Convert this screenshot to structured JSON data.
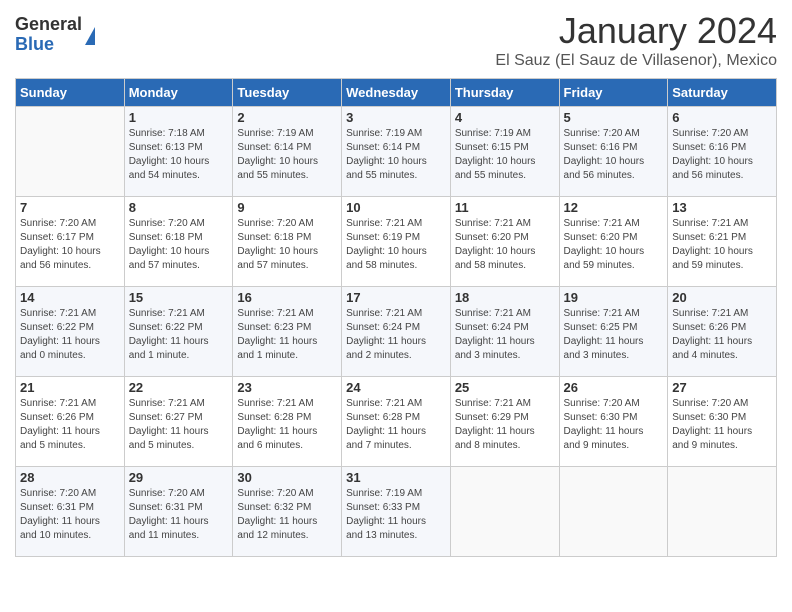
{
  "logo": {
    "general": "General",
    "blue": "Blue"
  },
  "title": "January 2024",
  "location": "El Sauz (El Sauz de Villasenor), Mexico",
  "headers": [
    "Sunday",
    "Monday",
    "Tuesday",
    "Wednesday",
    "Thursday",
    "Friday",
    "Saturday"
  ],
  "weeks": [
    [
      {
        "day": "",
        "info": ""
      },
      {
        "day": "1",
        "info": "Sunrise: 7:18 AM\nSunset: 6:13 PM\nDaylight: 10 hours\nand 54 minutes."
      },
      {
        "day": "2",
        "info": "Sunrise: 7:19 AM\nSunset: 6:14 PM\nDaylight: 10 hours\nand 55 minutes."
      },
      {
        "day": "3",
        "info": "Sunrise: 7:19 AM\nSunset: 6:14 PM\nDaylight: 10 hours\nand 55 minutes."
      },
      {
        "day": "4",
        "info": "Sunrise: 7:19 AM\nSunset: 6:15 PM\nDaylight: 10 hours\nand 55 minutes."
      },
      {
        "day": "5",
        "info": "Sunrise: 7:20 AM\nSunset: 6:16 PM\nDaylight: 10 hours\nand 56 minutes."
      },
      {
        "day": "6",
        "info": "Sunrise: 7:20 AM\nSunset: 6:16 PM\nDaylight: 10 hours\nand 56 minutes."
      }
    ],
    [
      {
        "day": "7",
        "info": "Sunrise: 7:20 AM\nSunset: 6:17 PM\nDaylight: 10 hours\nand 56 minutes."
      },
      {
        "day": "8",
        "info": "Sunrise: 7:20 AM\nSunset: 6:18 PM\nDaylight: 10 hours\nand 57 minutes."
      },
      {
        "day": "9",
        "info": "Sunrise: 7:20 AM\nSunset: 6:18 PM\nDaylight: 10 hours\nand 57 minutes."
      },
      {
        "day": "10",
        "info": "Sunrise: 7:21 AM\nSunset: 6:19 PM\nDaylight: 10 hours\nand 58 minutes."
      },
      {
        "day": "11",
        "info": "Sunrise: 7:21 AM\nSunset: 6:20 PM\nDaylight: 10 hours\nand 58 minutes."
      },
      {
        "day": "12",
        "info": "Sunrise: 7:21 AM\nSunset: 6:20 PM\nDaylight: 10 hours\nand 59 minutes."
      },
      {
        "day": "13",
        "info": "Sunrise: 7:21 AM\nSunset: 6:21 PM\nDaylight: 10 hours\nand 59 minutes."
      }
    ],
    [
      {
        "day": "14",
        "info": "Sunrise: 7:21 AM\nSunset: 6:22 PM\nDaylight: 11 hours\nand 0 minutes."
      },
      {
        "day": "15",
        "info": "Sunrise: 7:21 AM\nSunset: 6:22 PM\nDaylight: 11 hours\nand 1 minute."
      },
      {
        "day": "16",
        "info": "Sunrise: 7:21 AM\nSunset: 6:23 PM\nDaylight: 11 hours\nand 1 minute."
      },
      {
        "day": "17",
        "info": "Sunrise: 7:21 AM\nSunset: 6:24 PM\nDaylight: 11 hours\nand 2 minutes."
      },
      {
        "day": "18",
        "info": "Sunrise: 7:21 AM\nSunset: 6:24 PM\nDaylight: 11 hours\nand 3 minutes."
      },
      {
        "day": "19",
        "info": "Sunrise: 7:21 AM\nSunset: 6:25 PM\nDaylight: 11 hours\nand 3 minutes."
      },
      {
        "day": "20",
        "info": "Sunrise: 7:21 AM\nSunset: 6:26 PM\nDaylight: 11 hours\nand 4 minutes."
      }
    ],
    [
      {
        "day": "21",
        "info": "Sunrise: 7:21 AM\nSunset: 6:26 PM\nDaylight: 11 hours\nand 5 minutes."
      },
      {
        "day": "22",
        "info": "Sunrise: 7:21 AM\nSunset: 6:27 PM\nDaylight: 11 hours\nand 5 minutes."
      },
      {
        "day": "23",
        "info": "Sunrise: 7:21 AM\nSunset: 6:28 PM\nDaylight: 11 hours\nand 6 minutes."
      },
      {
        "day": "24",
        "info": "Sunrise: 7:21 AM\nSunset: 6:28 PM\nDaylight: 11 hours\nand 7 minutes."
      },
      {
        "day": "25",
        "info": "Sunrise: 7:21 AM\nSunset: 6:29 PM\nDaylight: 11 hours\nand 8 minutes."
      },
      {
        "day": "26",
        "info": "Sunrise: 7:20 AM\nSunset: 6:30 PM\nDaylight: 11 hours\nand 9 minutes."
      },
      {
        "day": "27",
        "info": "Sunrise: 7:20 AM\nSunset: 6:30 PM\nDaylight: 11 hours\nand 9 minutes."
      }
    ],
    [
      {
        "day": "28",
        "info": "Sunrise: 7:20 AM\nSunset: 6:31 PM\nDaylight: 11 hours\nand 10 minutes."
      },
      {
        "day": "29",
        "info": "Sunrise: 7:20 AM\nSunset: 6:31 PM\nDaylight: 11 hours\nand 11 minutes."
      },
      {
        "day": "30",
        "info": "Sunrise: 7:20 AM\nSunset: 6:32 PM\nDaylight: 11 hours\nand 12 minutes."
      },
      {
        "day": "31",
        "info": "Sunrise: 7:19 AM\nSunset: 6:33 PM\nDaylight: 11 hours\nand 13 minutes."
      },
      {
        "day": "",
        "info": ""
      },
      {
        "day": "",
        "info": ""
      },
      {
        "day": "",
        "info": ""
      }
    ]
  ],
  "row_classes": [
    "row-2",
    "row-3",
    "row-4",
    "row-5",
    "row-6"
  ]
}
